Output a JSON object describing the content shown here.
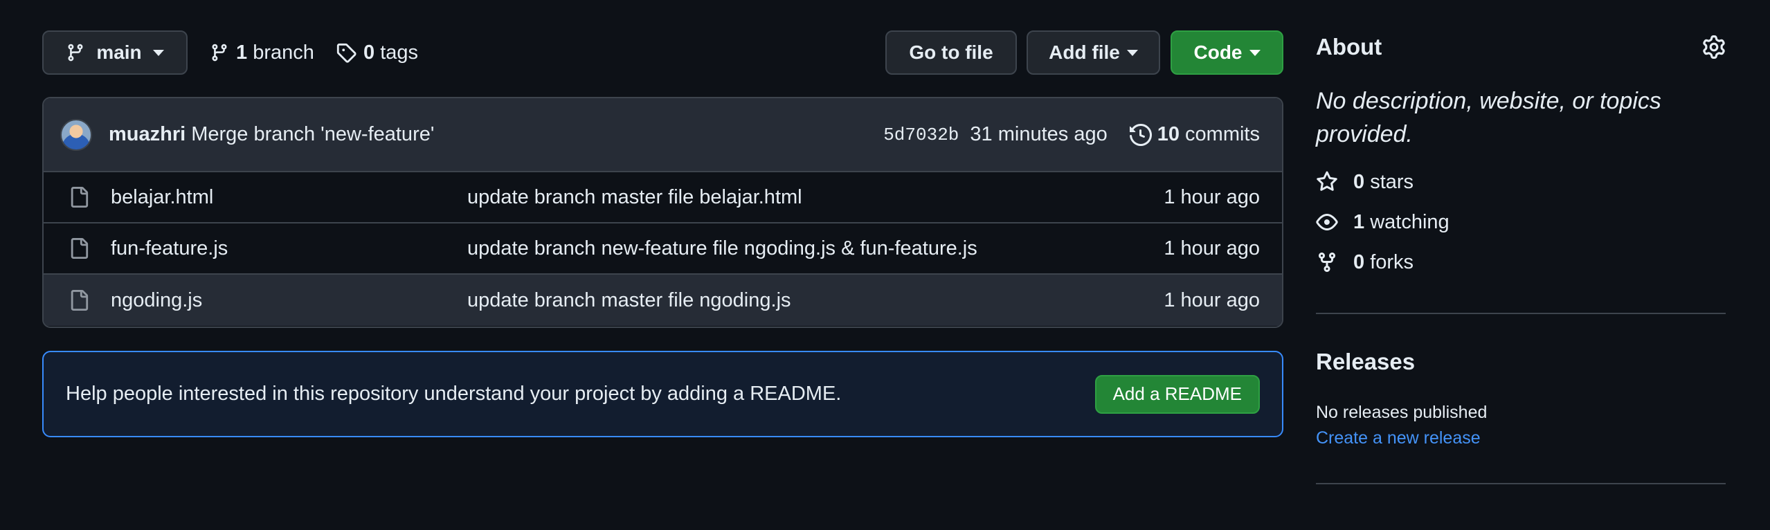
{
  "toolbar": {
    "branch_name": "main",
    "branch_count": "1",
    "branch_label": "branch",
    "tag_count": "0",
    "tag_label": "tags",
    "goto_file": "Go to file",
    "add_file": "Add file",
    "code": "Code"
  },
  "latest_commit": {
    "author": "muazhri",
    "message": "Merge branch 'new-feature'",
    "sha": "5d7032b",
    "time": "31 minutes ago",
    "commit_count": "10",
    "commit_label": "commits"
  },
  "files": [
    {
      "name": "belajar.html",
      "message": "update branch master file belajar.html",
      "time": "1 hour ago",
      "icon": "file-icon"
    },
    {
      "name": "fun-feature.js",
      "message": "update branch new-feature file ngoding.js & fun-feature.js",
      "time": "1 hour ago",
      "icon": "file-icon"
    },
    {
      "name": "ngoding.js",
      "message": "update branch master file ngoding.js",
      "time": "1 hour ago",
      "icon": "file-icon"
    }
  ],
  "readme_banner": {
    "text": "Help people interested in this repository understand your project by adding a README.",
    "button": "Add a README"
  },
  "about": {
    "title": "About",
    "description": "No description, website, or topics provided.",
    "stars_count": "0",
    "stars_label": "stars",
    "watching_count": "1",
    "watching_label": "watching",
    "forks_count": "0",
    "forks_label": "forks"
  },
  "releases": {
    "title": "Releases",
    "none_text": "No releases published",
    "create_link": "Create a new release"
  },
  "colors": {
    "background": "#0d1117",
    "primary_button": "#238636",
    "link": "#4493f8",
    "border": "#3d444d"
  }
}
